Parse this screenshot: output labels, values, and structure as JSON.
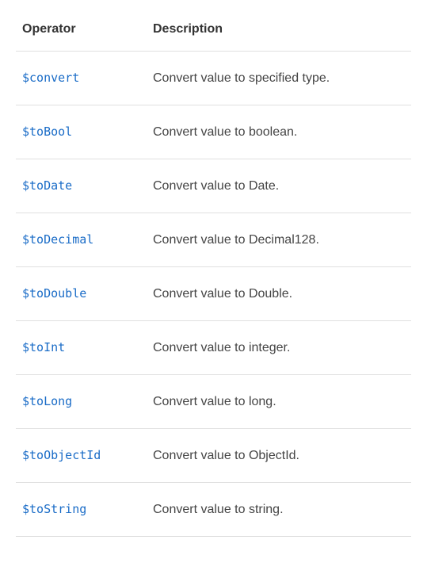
{
  "table": {
    "headers": {
      "operator": "Operator",
      "description": "Description"
    },
    "rows": [
      {
        "operator": "$convert",
        "description": "Convert value to specified type."
      },
      {
        "operator": "$toBool",
        "description": "Convert value to boolean."
      },
      {
        "operator": "$toDate",
        "description": "Convert value to Date."
      },
      {
        "operator": "$toDecimal",
        "description": "Convert value to Decimal128."
      },
      {
        "operator": "$toDouble",
        "description": "Convert value to Double."
      },
      {
        "operator": "$toInt",
        "description": "Convert value to integer."
      },
      {
        "operator": "$toLong",
        "description": "Convert value to long."
      },
      {
        "operator": "$toObjectId",
        "description": "Convert value to ObjectId."
      },
      {
        "operator": "$toString",
        "description": "Convert value to string."
      }
    ]
  }
}
